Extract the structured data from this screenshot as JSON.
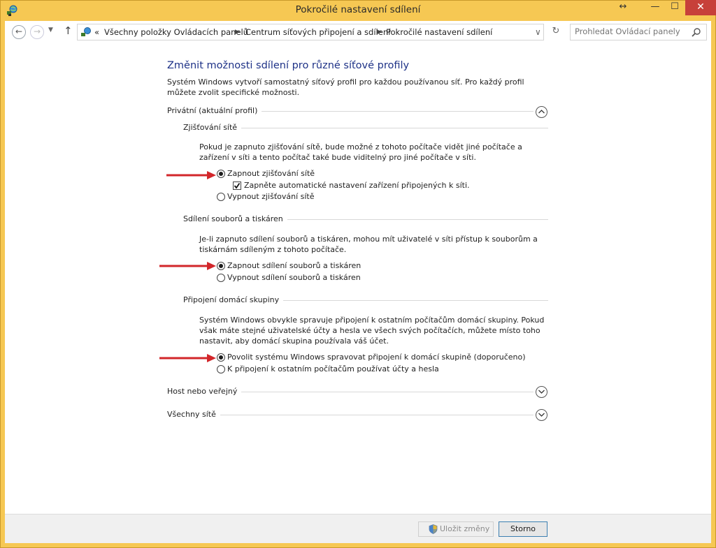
{
  "window": {
    "title": "Pokročilé nastavení sdílení",
    "close_glyph": "✕",
    "min_glyph": "—",
    "max_glyph": "☐",
    "resize_glyph": "↔"
  },
  "nav": {
    "back_glyph": "←",
    "forward_glyph": "→",
    "recent_glyph": "▼",
    "up_glyph": "↑",
    "overflow": "«",
    "breadcrumbs": [
      "Všechny položky Ovládacích panelů",
      "Centrum síťových připojení a sdílení",
      "Pokročilé nastavení sdílení"
    ],
    "separator": "▶",
    "dropdown_glyph": "∨",
    "refresh_glyph": "↻",
    "search_placeholder": "Prohledat Ovládací panely"
  },
  "main": {
    "title": "Změnit možnosti sdílení pro různé síťové profily",
    "intro": "Systém Windows vytvoří samostatný síťový profil pro každou používanou síť. Pro každý profil můžete zvolit specifické možnosti.",
    "profiles": [
      {
        "label": "Privátní (aktuální profil)",
        "expanded": true
      },
      {
        "label": "Host nebo veřejný",
        "expanded": false
      },
      {
        "label": "Všechny sítě",
        "expanded": false
      }
    ],
    "sections": {
      "discovery": {
        "heading": "Zjišťování sítě",
        "description": "Pokud je zapnuto zjišťování sítě, bude možné z tohoto počítače vidět jiné počítače a zařízení v síti a tento počítač také bude viditelný pro jiné počítače v síti.",
        "on_label": "Zapnout zjišťování sítě",
        "auto_label": "Zapněte automatické nastavení zařízení připojených k síti.",
        "off_label": "Vypnout zjišťování sítě",
        "selected": "on",
        "auto_checked": true
      },
      "sharing": {
        "heading": "Sdílení souborů a tiskáren",
        "description": "Je-li zapnuto sdílení souborů a tiskáren, mohou mít uživatelé v síti přístup k souborům a tiskárnám sdíleným z tohoto počítače.",
        "on_label": "Zapnout sdílení souborů a tiskáren",
        "off_label": "Vypnout sdílení souborů a tiskáren",
        "selected": "on"
      },
      "homegroup": {
        "heading": "Připojení domácí skupiny",
        "description": "Systém Windows obvykle spravuje připojení k ostatním počítačům domácí skupiny. Pokud však máte stejné uživatelské účty a hesla ve všech svých počítačích, můžete místo toho nastavit, aby domácí skupina používala váš účet.",
        "allow_label": "Povolit systému Windows spravovat připojení k domácí skupině (doporučeno)",
        "accounts_label": "K připojení k ostatním počítačům používat účty a hesla",
        "selected": "allow"
      }
    }
  },
  "footer": {
    "save_label": "Uložit změny",
    "cancel_label": "Storno"
  },
  "colors": {
    "frame": "#f6c853",
    "title_blue": "#1e3287",
    "close_red": "#c7403a",
    "arrow_red": "#d2262a"
  }
}
